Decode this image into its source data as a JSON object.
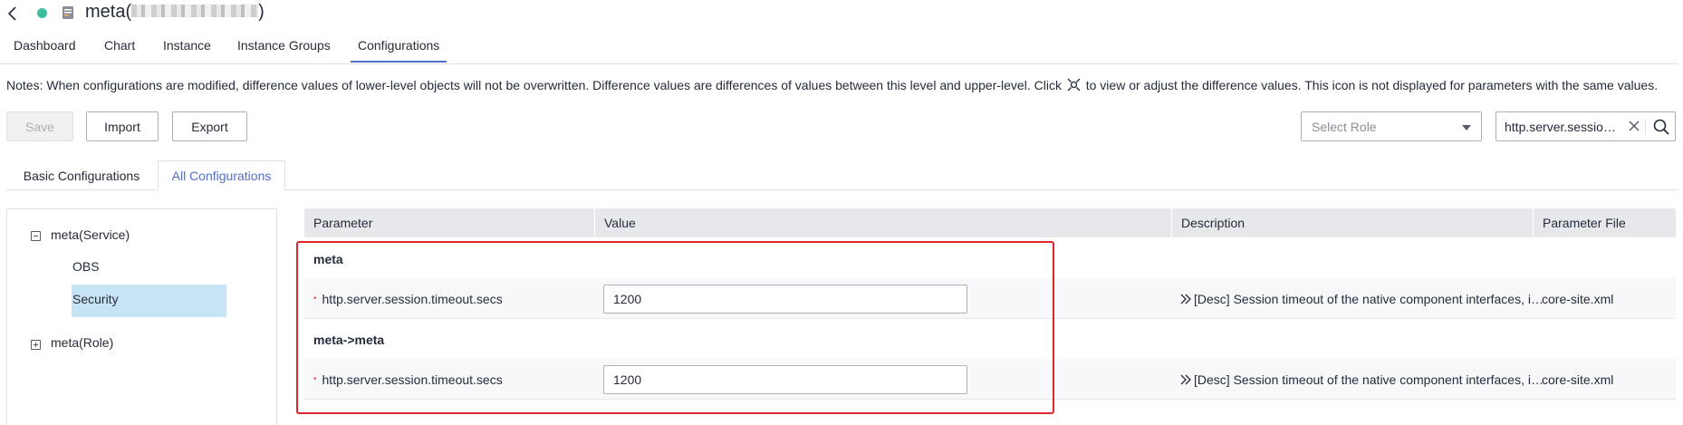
{
  "header": {
    "title_prefix": "meta(",
    "title_suffix": ")",
    "status_color": "#3bbf9c"
  },
  "main_tabs": [
    {
      "label": "Dashboard"
    },
    {
      "label": "Chart"
    },
    {
      "label": "Instance"
    },
    {
      "label": "Instance Groups"
    },
    {
      "label": "Configurations",
      "active": true
    }
  ],
  "notes": {
    "before_icon": "Notes: When configurations are modified, difference values of lower-level objects will not be overwritten. Difference values are differences of values between this level and upper-level. Click",
    "after_icon": "to view or adjust the difference values. This icon is not displayed for parameters with the same values."
  },
  "toolbar": {
    "save_label": "Save",
    "import_label": "Import",
    "export_label": "Export",
    "role_placeholder": "Select Role",
    "search_value": "http.server.session.timeout.secs"
  },
  "sub_tabs": [
    {
      "label": "Basic Configurations"
    },
    {
      "label": "All Configurations",
      "active": true
    }
  ],
  "tree": {
    "service_node": "meta(Service)",
    "children": [
      "OBS",
      "Security"
    ],
    "selected": "Security",
    "role_node": "meta(Role)"
  },
  "table": {
    "headers": [
      "Parameter",
      "Value",
      "Description",
      "Parameter File"
    ],
    "groups": [
      {
        "name": "meta",
        "rows": [
          {
            "parameter": "http.server.session.timeout.secs",
            "value": "1200",
            "description": "[Desc] Session timeout of the native component interfaces, in seconds.",
            "file": "core-site.xml"
          }
        ]
      },
      {
        "name": "meta->meta",
        "rows": [
          {
            "parameter": "http.server.session.timeout.secs",
            "value": "1200",
            "description": "[Desc] Session timeout of the native component interfaces, in seconds.",
            "file": "core-site.xml"
          }
        ]
      }
    ]
  },
  "colors": {
    "accent": "#526ecc",
    "highlight_border": "#e0262d",
    "selected_bg": "#c7e4f6"
  }
}
